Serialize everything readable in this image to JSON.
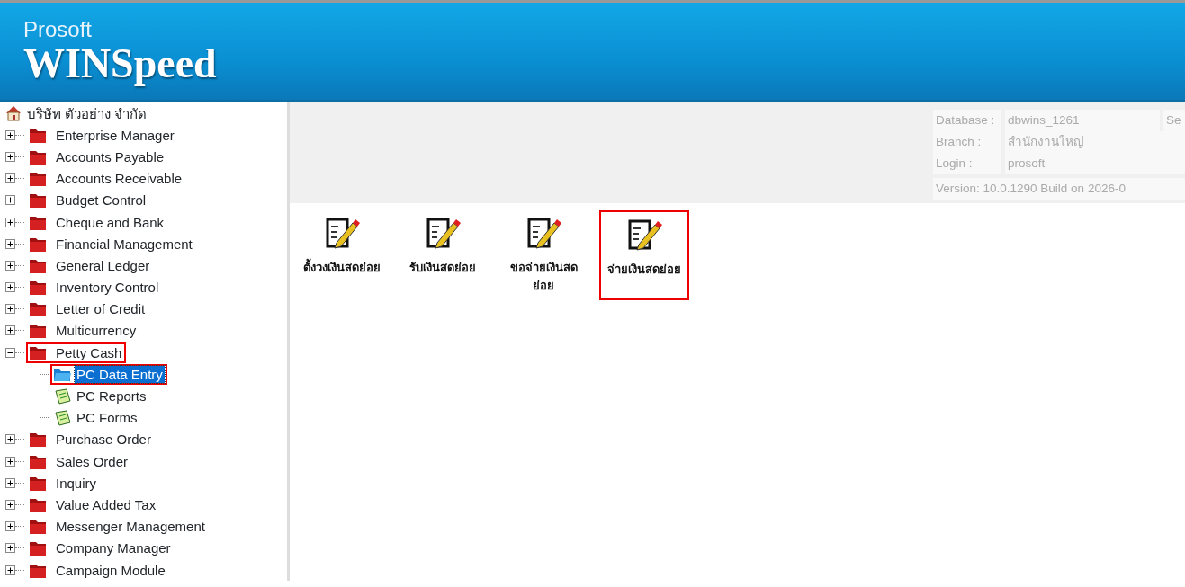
{
  "header": {
    "brand_small": "Prosoft",
    "brand_large": "WINSpeed"
  },
  "tree": {
    "root": "บริษัท ตัวอย่าง จำกัด",
    "items": [
      {
        "label": "Enterprise Manager",
        "expanded": false,
        "highlighted": false
      },
      {
        "label": "Accounts Payable",
        "expanded": false,
        "highlighted": false
      },
      {
        "label": "Accounts Receivable",
        "expanded": false,
        "highlighted": false
      },
      {
        "label": "Budget Control",
        "expanded": false,
        "highlighted": false
      },
      {
        "label": "Cheque and Bank",
        "expanded": false,
        "highlighted": false
      },
      {
        "label": "Financial Management",
        "expanded": false,
        "highlighted": false
      },
      {
        "label": "General Ledger",
        "expanded": false,
        "highlighted": false
      },
      {
        "label": "Inventory Control",
        "expanded": false,
        "highlighted": false
      },
      {
        "label": "Letter of Credit",
        "expanded": false,
        "highlighted": false
      },
      {
        "label": "Multicurrency",
        "expanded": false,
        "highlighted": false
      },
      {
        "label": "Petty Cash",
        "expanded": true,
        "highlighted": true,
        "children": [
          {
            "label": "PC Data Entry",
            "kind": "entry",
            "selected": true,
            "highlighted": true
          },
          {
            "label": "PC Reports",
            "kind": "report",
            "selected": false,
            "highlighted": false
          },
          {
            "label": "PC Forms",
            "kind": "report",
            "selected": false,
            "highlighted": false
          }
        ]
      },
      {
        "label": "Purchase Order",
        "expanded": false,
        "highlighted": false
      },
      {
        "label": "Sales Order",
        "expanded": false,
        "highlighted": false
      },
      {
        "label": "Inquiry",
        "expanded": false,
        "highlighted": false
      },
      {
        "label": "Value Added Tax",
        "expanded": false,
        "highlighted": false
      },
      {
        "label": "Messenger Management",
        "expanded": false,
        "highlighted": false
      },
      {
        "label": "Company Manager",
        "expanded": false,
        "highlighted": false
      },
      {
        "label": "Campaign Module",
        "expanded": false,
        "highlighted": false
      }
    ]
  },
  "info": {
    "rows": [
      {
        "label": "Database :",
        "value": "dbwins_1261",
        "extra": "Se"
      },
      {
        "label": "Branch :",
        "value": "สำนักงานใหญ่"
      },
      {
        "label": "Login :",
        "value": "prosoft"
      }
    ],
    "version": "Version: 10.0.1290  Build on 2026-0"
  },
  "shortcuts": [
    {
      "label": "ตั้งวงเงินสดย่อย",
      "highlighted": false
    },
    {
      "label": "รับเงินสดย่อย",
      "highlighted": false
    },
    {
      "label": "ขอจ่ายเงินสดย่อย",
      "highlighted": false
    },
    {
      "label": "จ่ายเงินสดย่อย",
      "highlighted": true
    }
  ]
}
